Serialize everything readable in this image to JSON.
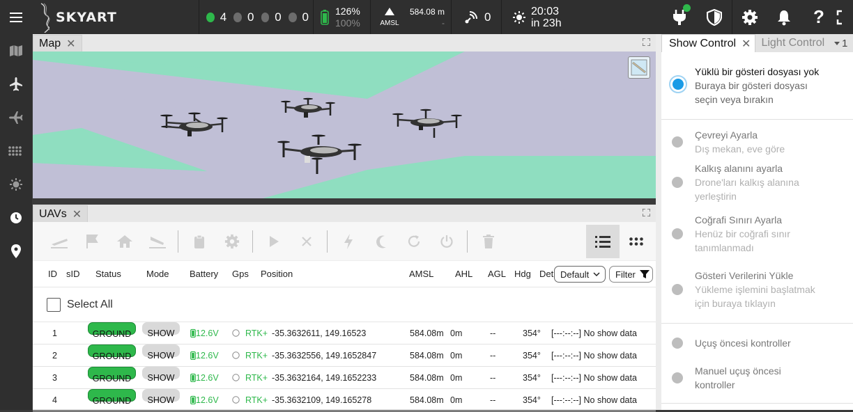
{
  "app": {
    "brand": "SKYART"
  },
  "status": {
    "uav_counts": [
      {
        "color": "#2eb84b",
        "value": "4"
      },
      {
        "color": "#7a7a7a",
        "value": "0"
      },
      {
        "color": "#7a7a7a",
        "value": "0"
      },
      {
        "color": "#7a7a7a",
        "value": "0"
      }
    ],
    "battery": {
      "primary": "126%",
      "secondary": "100%"
    },
    "altitude": {
      "value": "584.08 m",
      "ref": "AMSL",
      "dash": "-"
    },
    "rtk": {
      "value": "0"
    },
    "clock": {
      "time": "20:03",
      "remaining": "in 23h"
    }
  },
  "map_panel": {
    "tab_label": "Map",
    "close": "✕"
  },
  "uavs_panel": {
    "tab_label": "UAVs",
    "close": "✕",
    "columns": [
      "ID",
      "sID",
      "Status",
      "Mode",
      "Battery",
      "Gps",
      "Position",
      "AMSL",
      "AHL",
      "AGL",
      "Hdg",
      "Det"
    ],
    "view_select": "Default",
    "filter_label": "Filter",
    "select_all": "Select All",
    "rows": [
      {
        "id": "1",
        "status": "GROUND",
        "mode": "SHOW",
        "battery": "12.6V",
        "gps": "RTK+",
        "position": "-35.3632611, 149.16523",
        "amsl": "584.08m",
        "ahl": "0m",
        "agl": "--",
        "hdg": "354°",
        "det": "[---:--:--] No show data"
      },
      {
        "id": "2",
        "status": "GROUND",
        "mode": "SHOW",
        "battery": "12.6V",
        "gps": "RTK+",
        "position": "-35.3632556, 149.1652847",
        "amsl": "584.08m",
        "ahl": "0m",
        "agl": "--",
        "hdg": "354°",
        "det": "[---:--:--] No show data"
      },
      {
        "id": "3",
        "status": "GROUND",
        "mode": "SHOW",
        "battery": "12.6V",
        "gps": "RTK+",
        "position": "-35.3632164, 149.1652233",
        "amsl": "584.08m",
        "ahl": "0m",
        "agl": "--",
        "hdg": "354°",
        "det": "[---:--:--] No show data"
      },
      {
        "id": "4",
        "status": "GROUND",
        "mode": "SHOW",
        "battery": "12.6V",
        "gps": "RTK+",
        "position": "-35.3632109, 149.165278",
        "amsl": "584.08m",
        "ahl": "0m",
        "agl": "--",
        "hdg": "354°",
        "det": "[---:--:--] No show data"
      }
    ]
  },
  "show_control": {
    "tab_active": "Show Control",
    "tab_close": "✕",
    "tab_inactive": "Light Control",
    "tab_overflow": "1",
    "steps": [
      {
        "title": "Yüklü bir gösteri dosyası yok",
        "sub": "Buraya bir gösteri dosyası seçin veya bırakın",
        "active": true
      },
      {
        "title": "Çevreyi Ayarla",
        "sub": "Dış mekan, eve göre"
      },
      {
        "title": "Kalkış alanını ayarla",
        "sub": "Drone'ları kalkış alanına yerleştirin"
      },
      {
        "title": "Coğrafi Sınırı Ayarla",
        "sub": "Henüz bir coğrafi sınır tanımlanmadı"
      },
      {
        "title": "Gösteri Verilerini Yükle",
        "sub": "Yükleme işlemini başlatmak için buraya tıklayın"
      },
      {
        "title": "Uçuş öncesi kontroller",
        "sub": ""
      },
      {
        "title": "Manuel uçuş öncesi kontroller",
        "sub": ""
      }
    ]
  },
  "colors": {
    "accent_blue": "#1a9be6",
    "ground_green": "#2eb84b",
    "map_green": "#8fdec0",
    "map_purple": "#c0bfd6"
  }
}
